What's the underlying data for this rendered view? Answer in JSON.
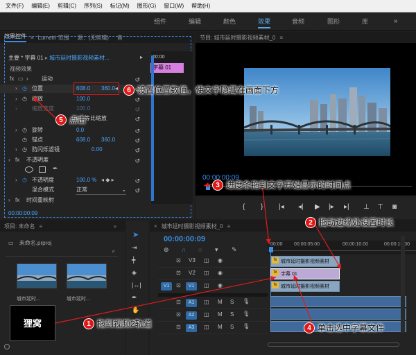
{
  "menu": [
    "文件(F)",
    "编辑(E)",
    "剪辑(C)",
    "序列(S)",
    "标记(M)",
    "图形(G)",
    "窗口(W)",
    "帮助(H)"
  ],
  "workspace_tabs": [
    "组件",
    "编辑",
    "颜色",
    "效果",
    "音频",
    "图形",
    "库"
  ],
  "workspace_active": "效果",
  "effect_controls": {
    "tabs": [
      "效果控件",
      "Lumetri 范围",
      "源：(无剪辑)",
      "音"
    ],
    "master": "主要 * 字幕 01",
    "sequence": "城市延时摄影视频素材...",
    "mini_time": "00:00",
    "mini_clip": "字幕 01",
    "video_effects": "视频效果",
    "motion": "运动",
    "position": "位置",
    "pos_x": "608.0",
    "pos_y": "360.0",
    "scale": "缩放",
    "scale_val": "100.0",
    "scale_width": "缩放宽度",
    "uniform": "等比缩放",
    "rotation": "旋转",
    "rotation_val": "0.0",
    "anchor": "锚点",
    "anchor_x": "608.0",
    "anchor_y": "360.0",
    "antiflicker": "防闪烁滤镜",
    "antiflicker_val": "0.00",
    "opacity": "不透明度",
    "opacity_prop": "不透明度",
    "opacity_val": "100.0 %",
    "blend": "混合模式",
    "blend_val": "正常",
    "timeremap": "时间重映射",
    "timecode": "00:00:00:09"
  },
  "program": {
    "title": "节目: 城市延时摄影视频素材_0",
    "timecode": "00:00:00:09"
  },
  "project": {
    "title": "项目: 未命名",
    "file": "未命名.prproj",
    "clip1": "城市延时...",
    "clip2": "城市延时...",
    "title_clip": "狸窝"
  },
  "timeline": {
    "title": "城市延时摄影视频素材_0",
    "timecode": "00:00:00:09",
    "ruler": [
      ":00:00",
      "00:00:05:00",
      "00:00:10:00",
      "00:00:15:00"
    ],
    "tracks": [
      {
        "name": "V3",
        "type": "video"
      },
      {
        "name": "V2",
        "type": "video"
      },
      {
        "name": "V1",
        "type": "video",
        "source": "V1"
      },
      {
        "name": "A1",
        "type": "audio"
      },
      {
        "name": "A2",
        "type": "audio"
      },
      {
        "name": "A3",
        "type": "audio"
      }
    ],
    "clip_v3": "城市延时摄影视频素材",
    "clip_v2": "字幕 01",
    "clip_v1": "城市延时摄影视频素材"
  },
  "callouts": [
    {
      "n": "1",
      "text": "拖到视频2轨道"
    },
    {
      "n": "2",
      "text": "拖动边缘处设置时长"
    },
    {
      "n": "3",
      "text": "进度条拖到文字开始显示的时间点"
    },
    {
      "n": "4",
      "text": "单击选中字幕文件"
    },
    {
      "n": "5",
      "text": "点击"
    },
    {
      "n": "6",
      "text": "设置位置数值，使文字隐藏在画面下方"
    }
  ]
}
